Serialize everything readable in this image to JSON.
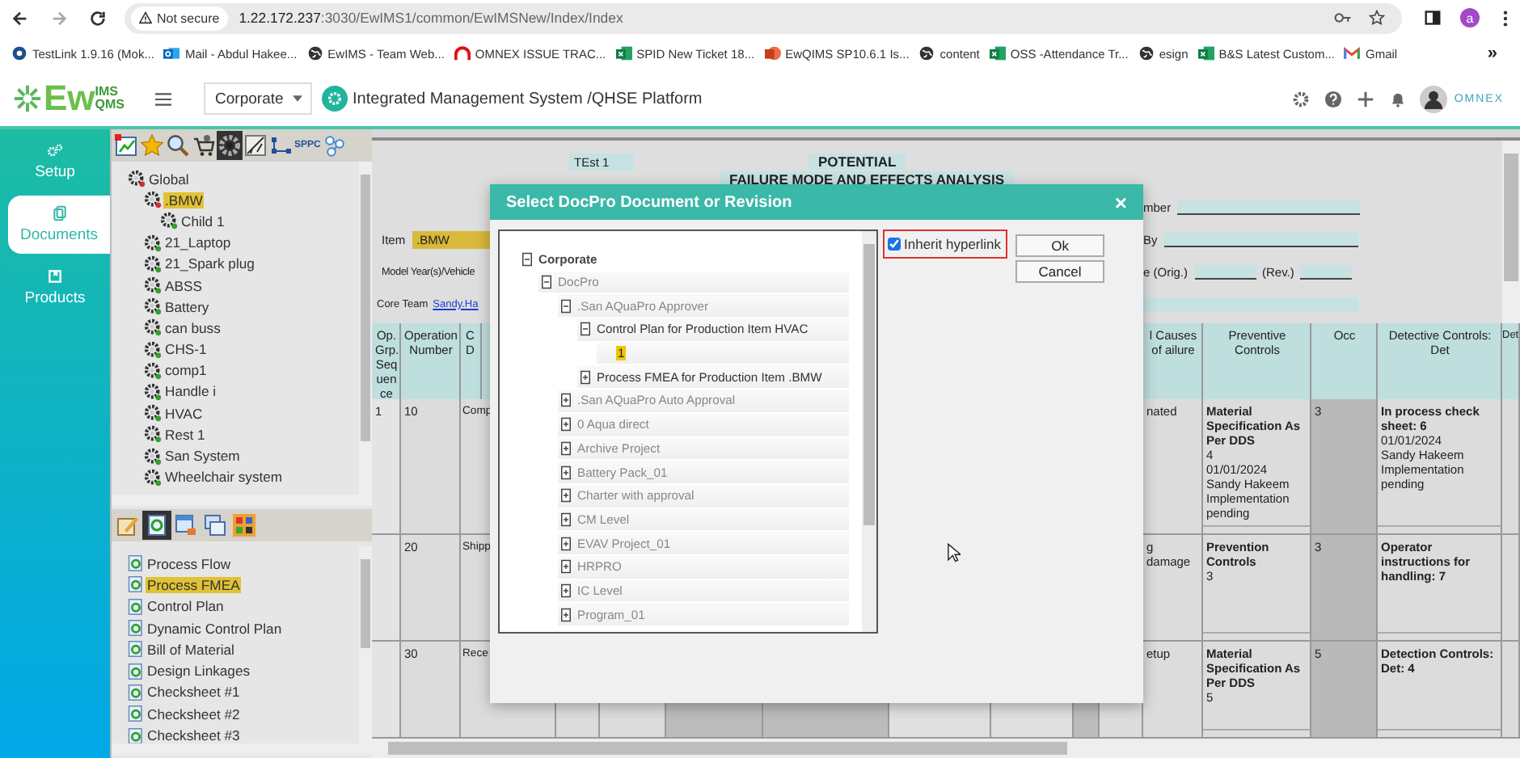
{
  "browser": {
    "security": "Not secure",
    "host": "1.22.172.237",
    "path": ":3030/EwIMS1/common/EwIMSNew/Index/Index",
    "profile": "a",
    "more": "»"
  },
  "bookmarks": [
    {
      "kind": "badge",
      "label": "TestLink 1.9.16 (Mok..."
    },
    {
      "kind": "mail",
      "label": "Mail - Abdul Hakee..."
    },
    {
      "kind": "globe",
      "label": "EwIMS - Team Web..."
    },
    {
      "kind": "arch",
      "label": "OMNEX ISSUE TRAC..."
    },
    {
      "kind": "sheet",
      "label": "SPID New Ticket 18..."
    },
    {
      "kind": "slides",
      "label": "EwQIMS SP10.6.1 Is..."
    },
    {
      "kind": "globe",
      "label": "content"
    },
    {
      "kind": "sheet",
      "label": "OSS -Attendance Tr..."
    },
    {
      "kind": "globe",
      "label": "esign"
    },
    {
      "kind": "sheet",
      "label": "B&S Latest Custom..."
    },
    {
      "kind": "gmail",
      "label": "Gmail"
    }
  ],
  "app": {
    "logo_main": "Ew",
    "logo_top": "IMS",
    "logo_bottom": "QMS",
    "site": "Corporate",
    "platform": "Integrated Management System /QHSE Platform",
    "brand": "OMNEX"
  },
  "nav": [
    {
      "kind": "gears",
      "label": "Setup",
      "selected": false
    },
    {
      "kind": "docs",
      "label": "Documents",
      "selected": true
    },
    {
      "kind": "box",
      "label": "Products",
      "selected": false
    }
  ],
  "tree_tools": [
    {
      "kind": "chart",
      "selected": false
    },
    {
      "kind": "star",
      "selected": false
    },
    {
      "kind": "search",
      "selected": false
    },
    {
      "kind": "cart",
      "selected": false
    },
    {
      "kind": "gear",
      "selected": true
    },
    {
      "kind": "ruler",
      "selected": false
    },
    {
      "kind": "flow",
      "label": "SPPC",
      "selected": false
    },
    {
      "kind": "nodes",
      "selected": false
    }
  ],
  "tree": [
    {
      "label": "Global",
      "color": "#d03030",
      "selected": false,
      "children": [
        {
          "label": ".BMW",
          "color": "#d03030",
          "selected": true,
          "children": [
            {
              "label": "Child 1",
              "color": "#30a030",
              "selected": false
            }
          ]
        },
        {
          "label": "21_Laptop",
          "color": "#30a030",
          "selected": false
        },
        {
          "label": "21_Spark plug",
          "color": "#30a030",
          "selected": false
        },
        {
          "label": "ABSS",
          "color": "#30a030",
          "selected": false
        },
        {
          "label": "Battery",
          "color": "#30a030",
          "selected": false
        },
        {
          "label": "can buss",
          "color": "#30a030",
          "selected": false
        },
        {
          "label": "CHS-1",
          "color": "#30a030",
          "selected": false
        },
        {
          "label": "comp1",
          "color": "#30a030",
          "selected": false
        },
        {
          "label": "Handle i",
          "color": "#30a030",
          "selected": false
        },
        {
          "label": "HVAC",
          "color": "#30a030",
          "selected": false
        },
        {
          "label": "Rest 1",
          "color": "#30a030",
          "selected": false
        },
        {
          "label": "San System",
          "color": "#30a030",
          "selected": false
        },
        {
          "label": "Wheelchair system",
          "color": "#30a030",
          "selected": false
        }
      ]
    }
  ],
  "doc_tools": [
    {
      "kind": "edit",
      "selected": false
    },
    {
      "kind": "doc",
      "selected": true
    },
    {
      "kind": "window",
      "selected": false
    },
    {
      "kind": "windows",
      "selected": false
    },
    {
      "kind": "grid",
      "selected": false
    }
  ],
  "doc_list": [
    {
      "label": "Process Flow",
      "selected": false
    },
    {
      "label": "Process FMEA",
      "selected": true
    },
    {
      "label": "Control Plan",
      "selected": false
    },
    {
      "label": "Dynamic Control Plan",
      "selected": false
    },
    {
      "label": "Bill of Material",
      "selected": false
    },
    {
      "label": "Design Linkages",
      "selected": false
    },
    {
      "label": "Checksheet #1",
      "selected": false
    },
    {
      "label": "Checksheet #2",
      "selected": false
    },
    {
      "label": "Checksheet #3",
      "selected": false
    }
  ],
  "form": {
    "name": "TEst 1",
    "title": "POTENTIAL",
    "subtitle": "FAILURE MODE AND EFFECTS ANALYSIS",
    "item_label": "Item",
    "item_value": ".BMW",
    "model_label": "Model Year(s)/Vehicle",
    "team_label": "Core Team",
    "team_value": "Sandy.Ha",
    "number_label": "mber",
    "by_label": "By",
    "date_label": "e (Orig.)",
    "rev_label": "(Rev.)"
  },
  "table": {
    "columns": [
      "Op. Grp. Seq uen ce",
      "Operation Number",
      "C D",
      "l Causes of ailure",
      "Preventive Controls",
      "Occ",
      "Detective Controls: Det",
      "Det"
    ],
    "rows": [
      {
        "seq": "1",
        "operation": "10",
        "column_3": "Comp",
        "causes": "nated",
        "preventive": {
          "title": "Material Specification As Per DDS",
          "details": [
            "4",
            "01/01/2024",
            "Sandy Hakeem",
            "Implementation pending"
          ]
        },
        "occ": "3",
        "detective": {
          "title": "In process check sheet: 6",
          "details": [
            "01/01/2024",
            "Sandy Hakeem",
            "Implementation pending"
          ]
        }
      },
      {
        "operation": "20",
        "column_3": "Shipp",
        "causes": "g damage",
        "preventive": {
          "title": "Prevention Controls",
          "details": [
            "3"
          ]
        },
        "occ": "3",
        "detective": {
          "title": "Operator instructions for handling: 7"
        }
      },
      {
        "operation": "30",
        "column_3": "Rece",
        "causes": "etup",
        "preventive": {
          "title": "Material Specification As Per DDS",
          "details": [
            "5"
          ]
        },
        "occ": "5",
        "detective": {
          "title": "Detection Controls: Det: 4"
        }
      }
    ]
  },
  "dialog": {
    "title": "Select DocPro Document or Revision",
    "close": "×",
    "inherit": {
      "label": "Inherit hyperlink",
      "checked": true
    },
    "buttons": [
      "Ok",
      "Cancel"
    ],
    "tree": [
      {
        "kind": "root",
        "label": "Corporate",
        "expanded": true,
        "selected": false,
        "children": [
          {
            "kind": "folder",
            "label": "DocPro",
            "expanded": true,
            "selected": false,
            "children": [
              {
                "kind": "folder",
                "label": ".San AQuaPro Approver",
                "expanded": true,
                "selected": false,
                "children": [
                  {
                    "kind": "document",
                    "label": "Control Plan for Production Item HVAC",
                    "expanded": true,
                    "selected": false,
                    "children": [
                      {
                        "kind": "revision",
                        "label": "1",
                        "selected": true
                      }
                    ]
                  },
                  {
                    "kind": "document",
                    "label": "Process FMEA for Production Item .BMW",
                    "expanded": false,
                    "selected": false
                  }
                ]
              },
              {
                "kind": "folder",
                "label": ".San AQuaPro Auto Approval",
                "expanded": false,
                "selected": false
              },
              {
                "kind": "folder",
                "label": "0 Aqua direct",
                "expanded": false,
                "selected": false
              },
              {
                "kind": "folder",
                "label": "Archive Project",
                "expanded": false,
                "selected": false
              },
              {
                "kind": "folder",
                "label": "Battery Pack_01",
                "expanded": false,
                "selected": false
              },
              {
                "kind": "folder",
                "label": "Charter with approval",
                "expanded": false,
                "selected": false
              },
              {
                "kind": "folder",
                "label": "CM Level",
                "expanded": false,
                "selected": false
              },
              {
                "kind": "folder",
                "label": "EVAV Project_01",
                "expanded": false,
                "selected": false
              },
              {
                "kind": "folder",
                "label": "HRPRO",
                "expanded": false,
                "selected": false
              },
              {
                "kind": "folder",
                "label": "IC Level",
                "expanded": false,
                "selected": false
              },
              {
                "kind": "folder",
                "label": "Program_01",
                "expanded": false,
                "selected": false
              }
            ]
          }
        ]
      }
    ]
  }
}
